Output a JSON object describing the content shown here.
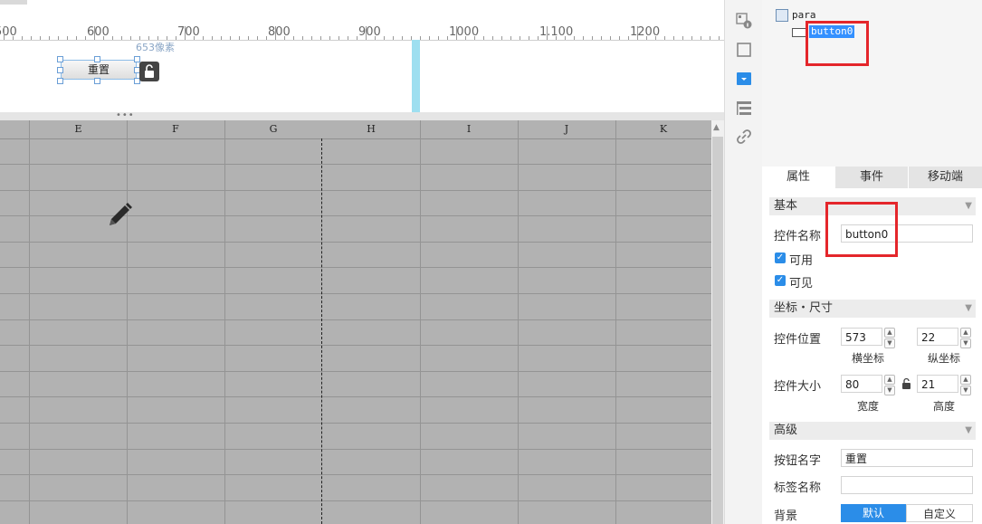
{
  "ruler": {
    "labels": [
      "500",
      "600",
      "700",
      "800",
      "900",
      "1000",
      "1.100",
      "1200"
    ],
    "pixel_hint": "653像素"
  },
  "design": {
    "reset_button_label": "重置"
  },
  "grid": {
    "columns": [
      "E",
      "F",
      "G",
      "H",
      "I",
      "J",
      "K"
    ]
  },
  "toolbar": {
    "icons": [
      "component-info-icon",
      "frame-icon",
      "dropdown-icon",
      "list-edit-icon",
      "link-icon"
    ]
  },
  "tree": {
    "root": "para",
    "child": "button0"
  },
  "tabs": [
    "属性",
    "事件",
    "移动端"
  ],
  "props": {
    "basic_section": "基本",
    "name_label": "控件名称",
    "name_value": "button0",
    "enabled_label": "可用",
    "visible_label": "可见",
    "coord_section": "坐标・尺寸",
    "pos_label": "控件位置",
    "x_value": "573",
    "y_value": "22",
    "x_caption": "横坐标",
    "y_caption": "纵坐标",
    "size_label": "控件大小",
    "w_value": "80",
    "h_value": "21",
    "w_caption": "宽度",
    "h_caption": "高度",
    "advanced_section": "高级",
    "btn_text_label": "按钮名字",
    "btn_text_value": "重置",
    "tag_label": "标签名称",
    "tag_value": "",
    "bg_label": "背景",
    "bg_default": "默认",
    "bg_custom": "自定义"
  },
  "colors": {
    "accent": "#2b8de8",
    "highlight_box": "#e4262b",
    "grid_bg": "#b2b2b2",
    "canvas_edge": "#9edff0"
  }
}
